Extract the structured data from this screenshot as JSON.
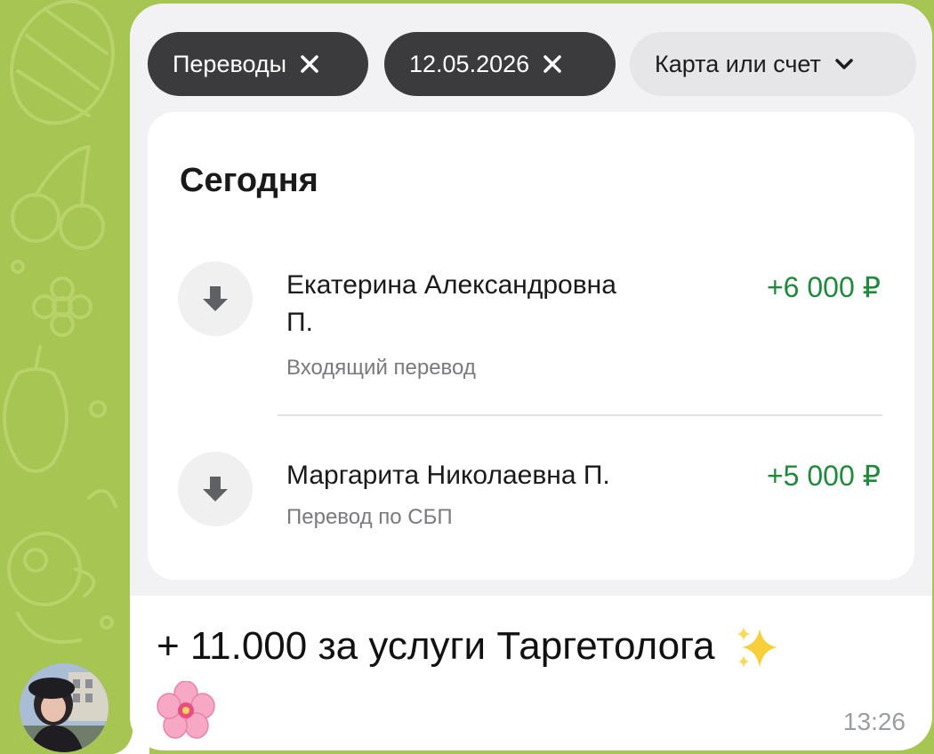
{
  "filters": {
    "chip1_label": "Переводы",
    "chip2_label": "12.05.2026",
    "chip3_label": "Карта или счет"
  },
  "history": {
    "section_title": "Сегодня",
    "transactions": [
      {
        "name_line1": "Екатерина Александровна",
        "name_line2": "П.",
        "type": "Входящий перевод",
        "amount": "+6 000 ₽",
        "icon": "arrow-down-icon"
      },
      {
        "name_line1": "Маргарита Николаевна П.",
        "type": "Перевод по СБП",
        "amount": "+5 000 ₽",
        "icon": "arrow-down-icon"
      }
    ]
  },
  "message": {
    "text": "+ 11.000 за услуги Таргетолога",
    "emoji_1": "sparkles-icon",
    "emoji_2": "cherry-blossom-icon",
    "time": "13:26"
  },
  "colors": {
    "wallpaper": "#a6c552",
    "amount_green": "#1f8a3b",
    "chip_dark": "#3b3b3d"
  }
}
